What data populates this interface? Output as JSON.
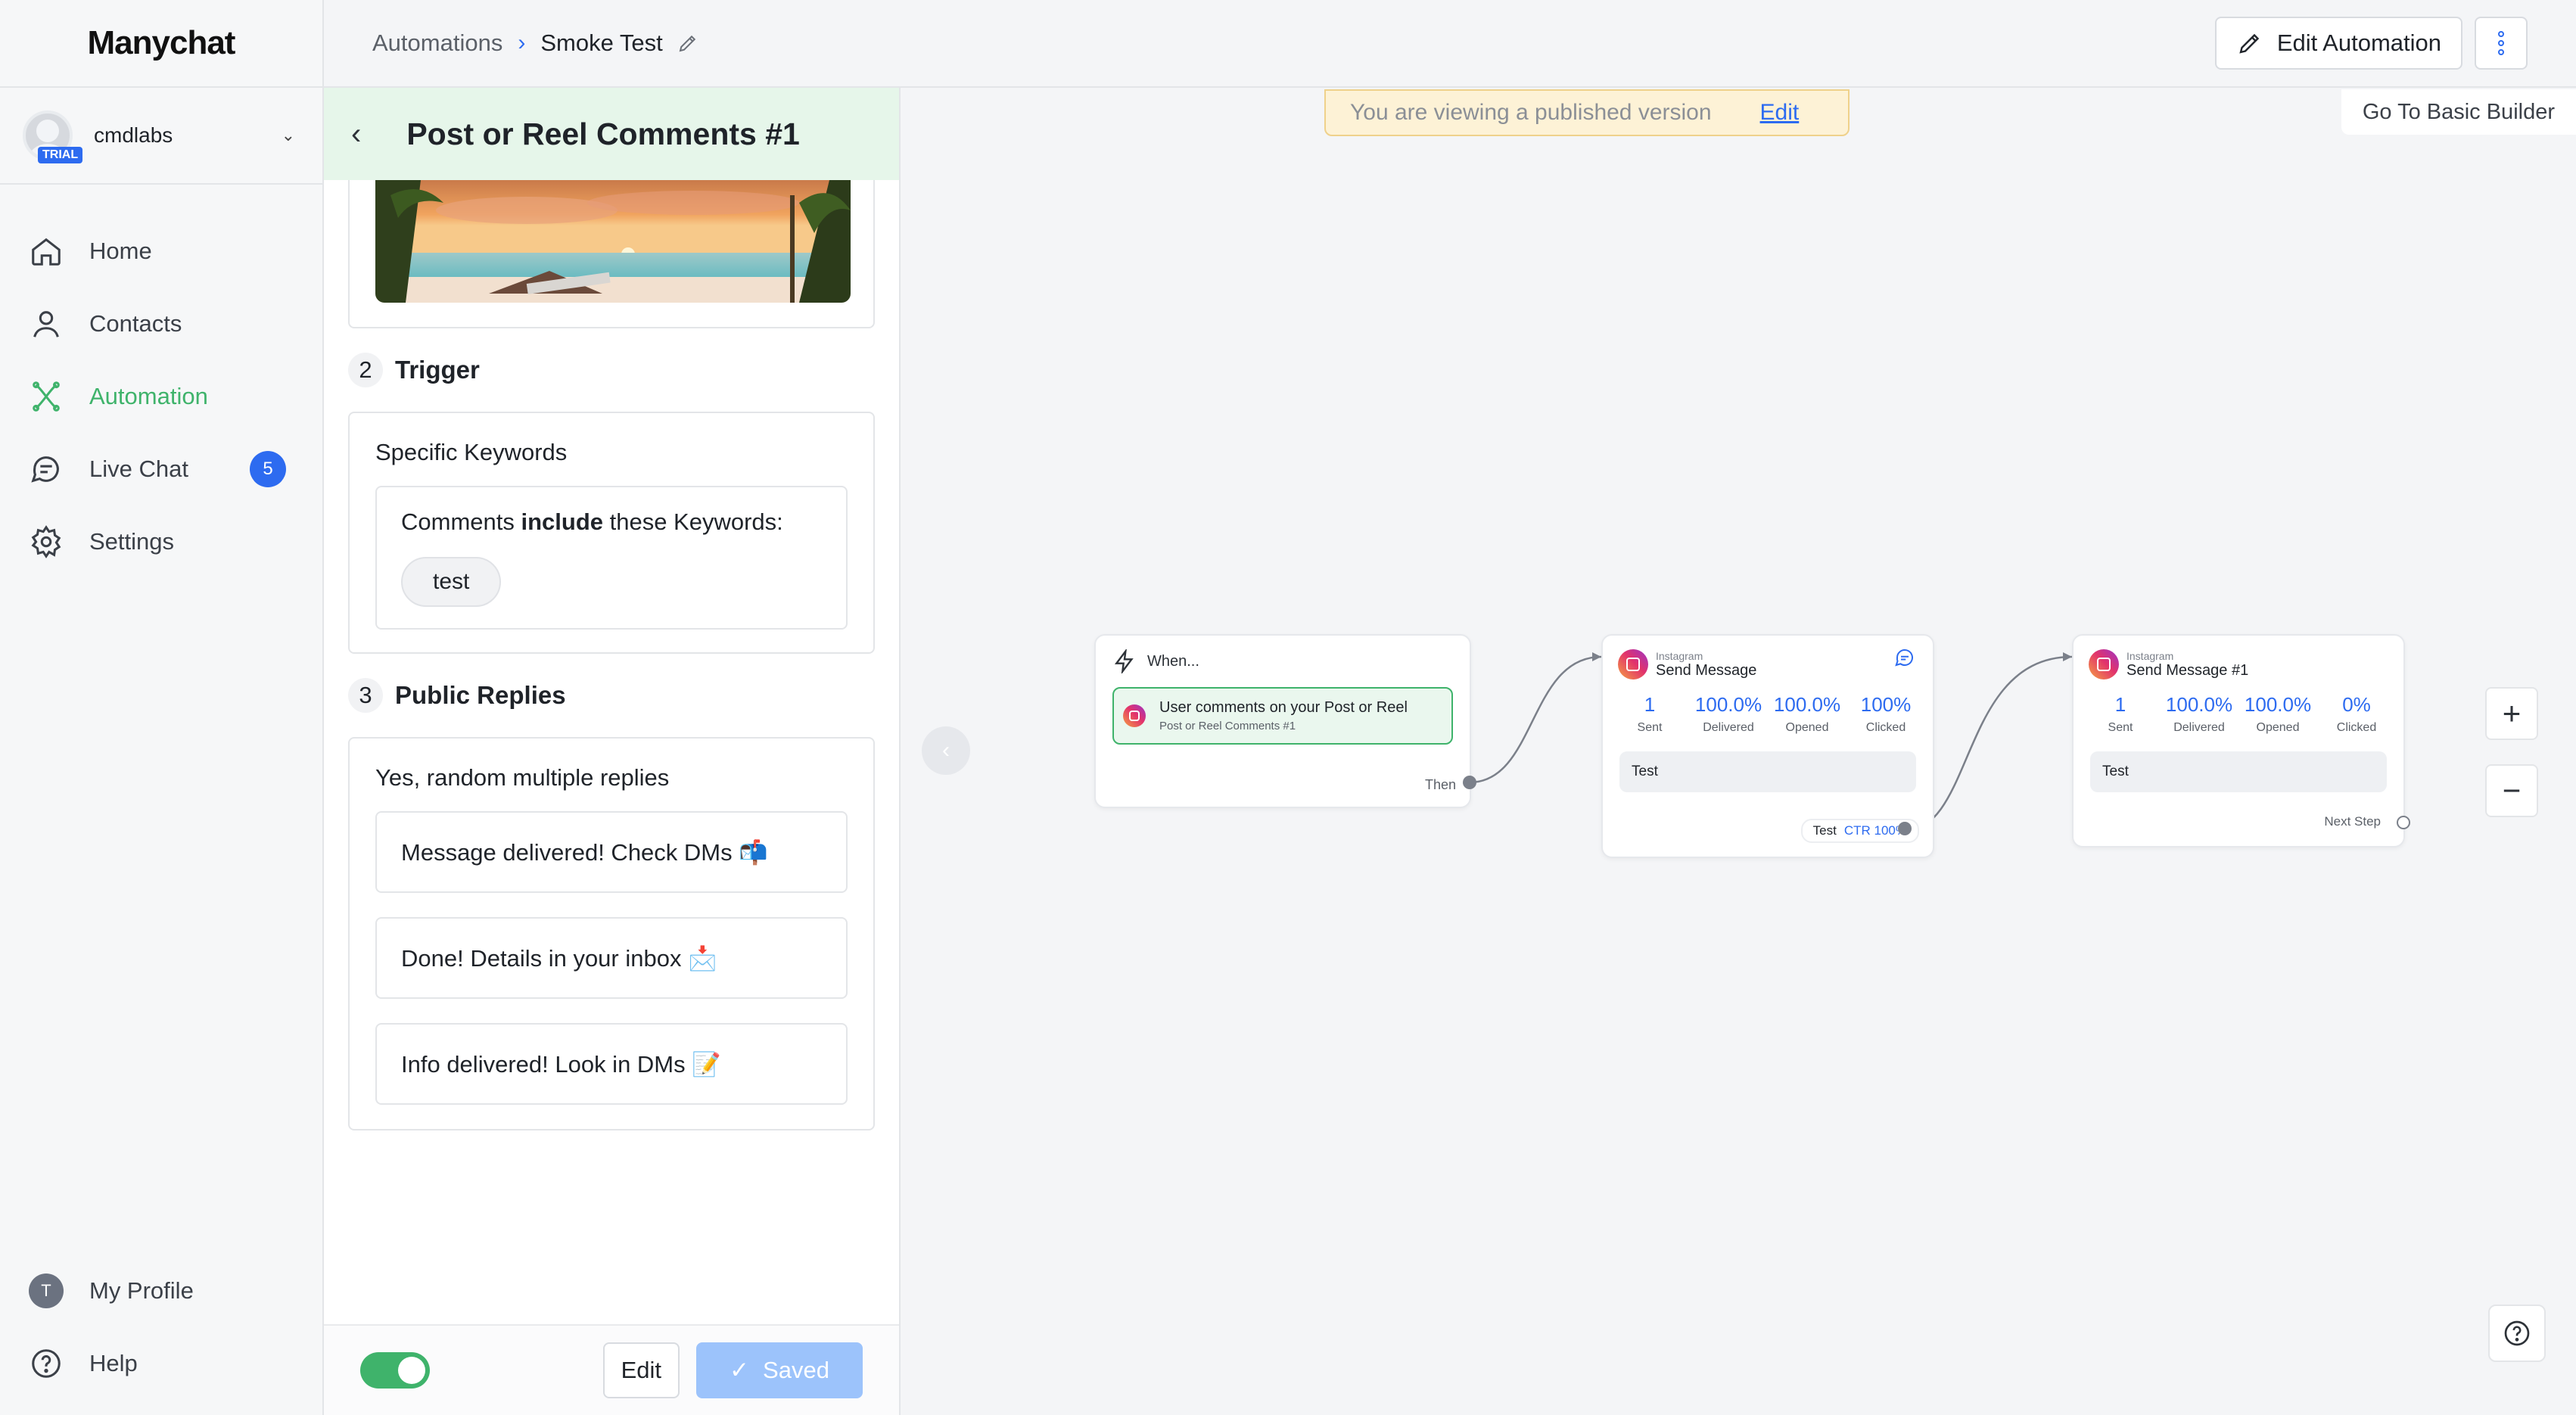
{
  "brand": {
    "name": "Manychat"
  },
  "account": {
    "name": "cmdlabs",
    "badge": "TRIAL"
  },
  "sidebar": {
    "items": [
      {
        "label": "Home",
        "icon": "home-icon"
      },
      {
        "label": "Contacts",
        "icon": "person-icon"
      },
      {
        "label": "Automation",
        "icon": "automation-icon",
        "active": true
      },
      {
        "label": "Live Chat",
        "icon": "chat-icon",
        "badge": "5"
      },
      {
        "label": "Settings",
        "icon": "gear-icon"
      }
    ],
    "bottom": [
      {
        "label": "My Profile",
        "initial": "T"
      },
      {
        "label": "Help",
        "icon": "help-icon"
      }
    ]
  },
  "header": {
    "breadcrumb_root": "Automations",
    "breadcrumb_current": "Smoke Test",
    "edit_automation_label": "Edit Automation"
  },
  "panel": {
    "title": "Post or Reel Comments #1",
    "trigger": {
      "num": "2",
      "title": "Trigger",
      "heading": "Specific Keywords",
      "rule_prefix": "Comments ",
      "rule_bold": "include",
      "rule_suffix": " these Keywords:",
      "keyword": "test"
    },
    "replies": {
      "num": "3",
      "title": "Public Replies",
      "heading": "Yes, random multiple replies",
      "items": [
        "Message delivered! Check DMs 📬",
        "Done! Details in your inbox 📩",
        "Info delivered! Look in DMs 📝"
      ]
    },
    "footer": {
      "edit_label": "Edit",
      "saved_label": "Saved",
      "toggle_on": true
    }
  },
  "canvas": {
    "banner_text": "You are viewing a published version",
    "banner_link": "Edit",
    "basic_builder_label": "Go To Basic Builder",
    "when_node": {
      "title": "When...",
      "trigger_main": "User comments on your Post or Reel",
      "trigger_sub": "Post or Reel Comments #1",
      "then_label": "Then"
    },
    "message_nodes": [
      {
        "platform": "Instagram",
        "title": "Send Message",
        "stats": [
          {
            "value": "1",
            "label": "Sent"
          },
          {
            "value": "100.0%",
            "label": "Delivered"
          },
          {
            "value": "100.0%",
            "label": "Opened"
          },
          {
            "value": "100%",
            "label": "Clicked"
          }
        ],
        "text": "Test",
        "button_label": "Test",
        "button_ctr": "CTR 100%"
      },
      {
        "platform": "Instagram",
        "title": "Send Message #1",
        "stats": [
          {
            "value": "1",
            "label": "Sent"
          },
          {
            "value": "100.0%",
            "label": "Delivered"
          },
          {
            "value": "100.0%",
            "label": "Opened"
          },
          {
            "value": "0%",
            "label": "Clicked"
          }
        ],
        "text": "Test",
        "next_step_label": "Next Step"
      }
    ],
    "zoom_in": "+",
    "zoom_out": "−"
  },
  "colors": {
    "accent_green": "#3fb36b",
    "accent_blue": "#2d6bf0",
    "banner_bg": "#fdf2d6"
  }
}
